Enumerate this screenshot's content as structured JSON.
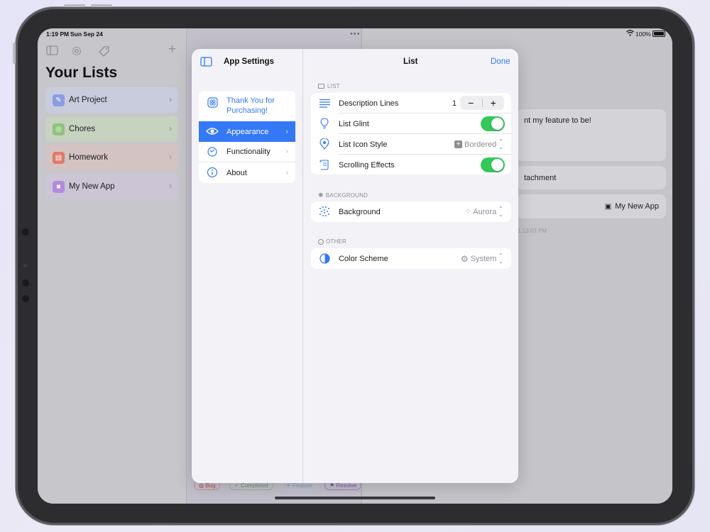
{
  "status": {
    "time": "1:19 PM",
    "date": "Sun Sep 24",
    "battery": "100%"
  },
  "sidebar": {
    "title": "Your Lists",
    "lists": [
      {
        "label": "Art Project",
        "color": "#8b9ce0",
        "bg": "#c9ccdd"
      },
      {
        "label": "Chores",
        "color": "#8fc47a",
        "bg": "#c7d2c0"
      },
      {
        "label": "Homework",
        "color": "#e07a6a",
        "bg": "#d3c3c2"
      },
      {
        "label": "My New App",
        "color": "#b48ae0",
        "bg": "#cbc5d6"
      }
    ]
  },
  "detail": {
    "message": "nt my feature to be!",
    "attachment": "tachment",
    "app_chip": "My New App",
    "timestamp": "1:13:03 PM",
    "tags": [
      "Bug",
      "Completed",
      "Feature",
      "Resolve"
    ]
  },
  "modal": {
    "sidebar_title": "App Settings",
    "main_title": "List",
    "done_label": "Done",
    "nav": [
      {
        "label": "Thank You for Purchasing!"
      },
      {
        "label": "Appearance"
      },
      {
        "label": "Functionality"
      },
      {
        "label": "About"
      }
    ],
    "sections": {
      "list_header": "LIST",
      "background_header": "BACKGROUND",
      "other_header": "OTHER"
    },
    "rows": {
      "description_lines": {
        "label": "Description Lines",
        "value": "1",
        "minus": "−",
        "plus": "+"
      },
      "list_glint": {
        "label": "List Glint",
        "on": true
      },
      "list_icon_style": {
        "label": "List Icon Style",
        "value": "Bordered"
      },
      "scrolling_effects": {
        "label": "Scrolling Effects",
        "on": true
      },
      "background": {
        "label": "Background",
        "value": "Aurora"
      },
      "color_scheme": {
        "label": "Color Scheme",
        "value": "System"
      }
    },
    "accent": "#3478f6",
    "toggle_color": "#34c759"
  }
}
